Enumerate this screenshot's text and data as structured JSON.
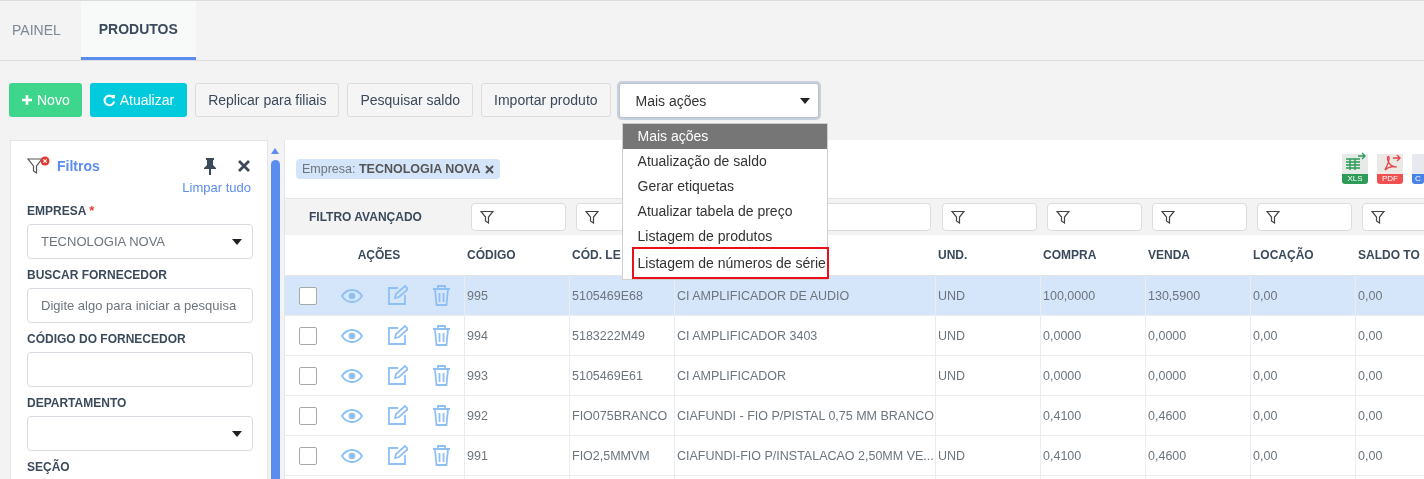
{
  "tabs": [
    {
      "label": "PAINEL",
      "selected": false
    },
    {
      "label": "PRODUTOS",
      "selected": true
    }
  ],
  "toolbar": {
    "buttons": [
      {
        "label": "Novo",
        "kind": "new"
      },
      {
        "label": "Atualizar",
        "kind": "refresh"
      },
      {
        "label": "Replicar para filiais",
        "kind": "plain"
      },
      {
        "label": "Pesquisar saldo",
        "kind": "plain"
      },
      {
        "label": "Importar produto",
        "kind": "plain"
      }
    ],
    "more_actions": {
      "value": "Mais ações",
      "expanded": true,
      "options": [
        {
          "label": "Mais ações",
          "selected": true,
          "annotated": false
        },
        {
          "label": "Atualização de saldo",
          "selected": false,
          "annotated": false
        },
        {
          "label": "Gerar etiquetas",
          "selected": false,
          "annotated": false
        },
        {
          "label": "Atualizar tabela de preço",
          "selected": false,
          "annotated": false
        },
        {
          "label": "Listagem de produtos",
          "selected": false,
          "annotated": false
        },
        {
          "label": "Listagem de números de série",
          "selected": false,
          "annotated": true
        }
      ]
    }
  },
  "filters": {
    "title": "Filtros",
    "clear_all": "Limpar tudo",
    "fields": [
      {
        "label": "EMPRESA",
        "required_mark": "*",
        "kind": "select",
        "value": "TECNOLOGIA NOVA"
      },
      {
        "label": "BUSCAR FORNECEDOR",
        "kind": "text",
        "placeholder": "Digite algo para iniciar a pesquisa"
      },
      {
        "label": "CÓDIGO DO FORNECEDOR",
        "kind": "text"
      },
      {
        "label": "DEPARTAMENTO",
        "kind": "select"
      },
      {
        "label": "SEÇÃO",
        "kind": "label"
      }
    ]
  },
  "active_filter_chip": "Empresa: **TECNOLOGIA NOVA**",
  "exports": [
    "XLS",
    "PDF",
    "C"
  ],
  "table": {
    "advanced_filter_label": "FILTRO AVANÇADO",
    "actions_label": "AÇÕES",
    "columns": [
      "CÓDIGO",
      "CÓD. LE",
      null,
      "UND.",
      "COMPRA",
      "VENDA",
      "LOCAÇÃO",
      "SALDO TO"
    ],
    "rows": [
      {
        "selected": true,
        "checked": false,
        "cells": [
          "995",
          "5105469E68",
          "CI AMPLIFICADOR DE AUDIO",
          "UND",
          "100,0000",
          "130,5900",
          "0,00",
          "0,00"
        ]
      },
      {
        "selected": false,
        "checked": false,
        "cells": [
          "994",
          "5183222M49",
          "CI AMPLIFICADOR 3403",
          "UND",
          "0,0000",
          "0,0000",
          "0,00",
          "0,00"
        ]
      },
      {
        "selected": false,
        "checked": false,
        "cells": [
          "993",
          "5105469E61",
          "CI AMPLIFICADOR",
          "UND",
          "0,0000",
          "0,0000",
          "0,00",
          "0,00"
        ]
      },
      {
        "selected": false,
        "checked": false,
        "cells": [
          "992",
          "FIO075BRANCO",
          "CIAFUNDI - FIO P/PISTAL 0,75 MM BRANCO",
          null,
          "0,4100",
          "0,4600",
          "0,00",
          "0,00"
        ]
      },
      {
        "selected": false,
        "checked": false,
        "cells": [
          "991",
          "FIO2,5MMVM",
          "CIAFUNDI-FIO P/INSTALACAO 2,50MM VE...",
          "UND",
          "0,4100",
          "0,4600",
          "0,00",
          "0,00"
        ]
      }
    ]
  }
}
